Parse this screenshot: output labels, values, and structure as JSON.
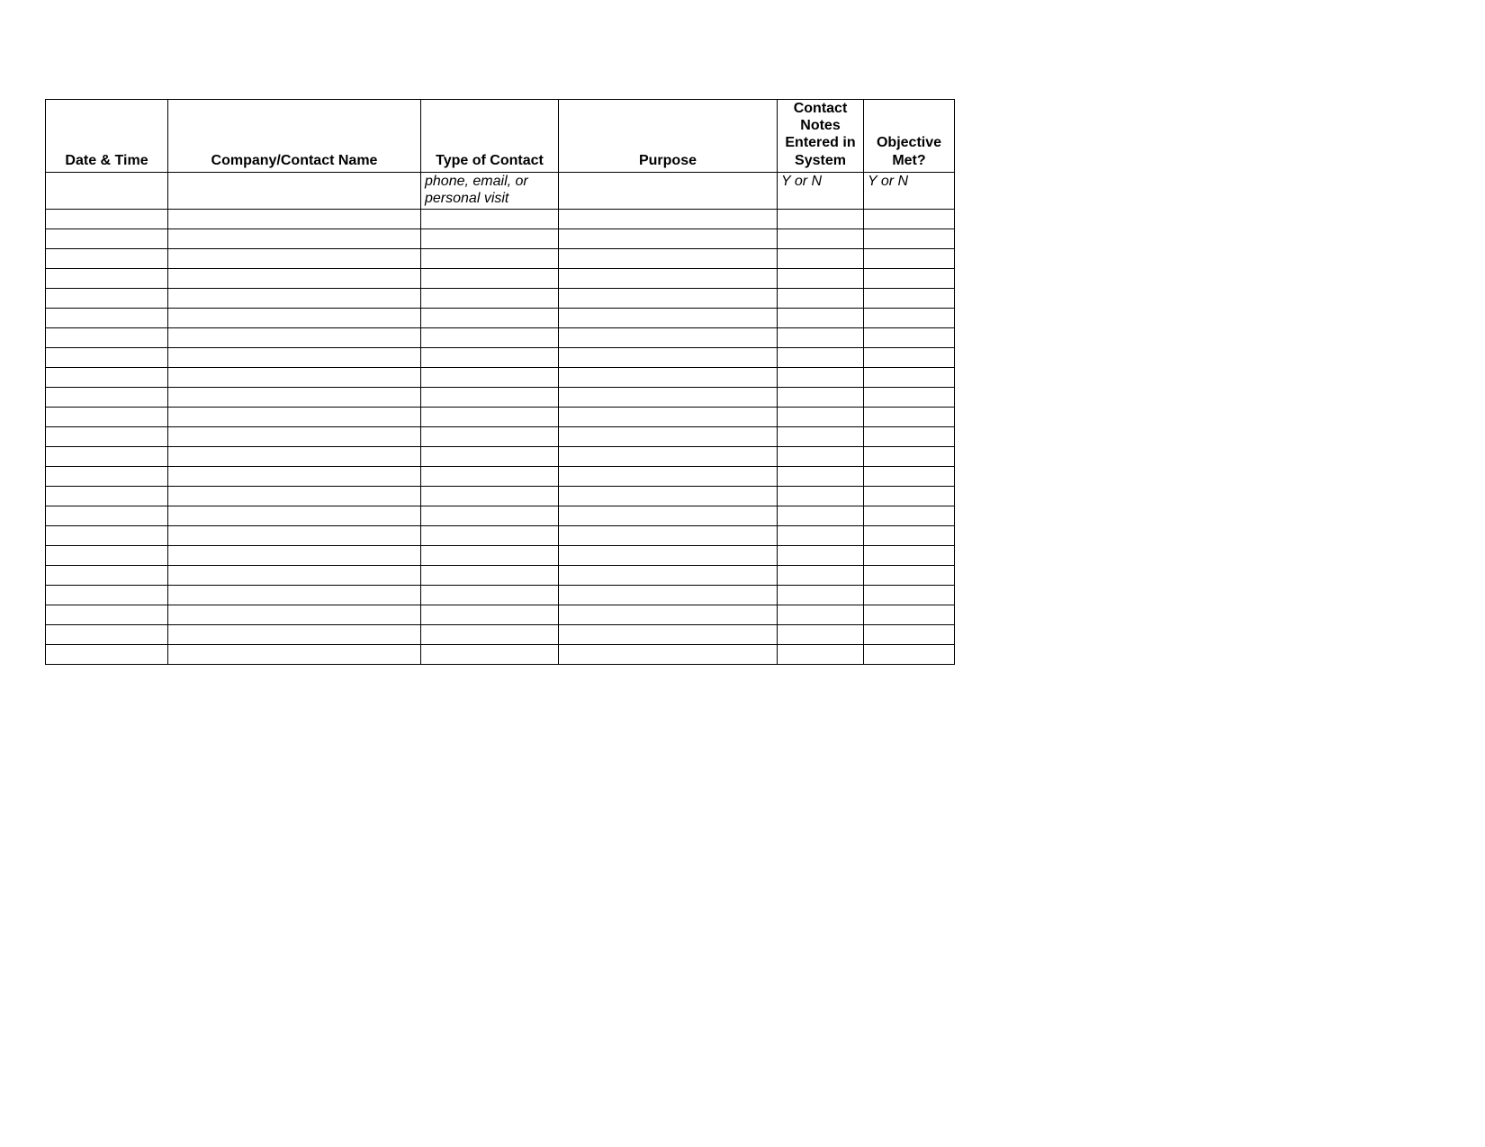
{
  "table": {
    "headers": {
      "date_time": "Date & Time",
      "company_contact": "Company/Contact Name",
      "type_of_contact": "Type of Contact",
      "purpose": "Purpose",
      "notes_entered": "Contact Notes Entered in System",
      "objective_met": "Objective Met?"
    },
    "hints": {
      "type_of_contact": "phone, email, or personal visit",
      "notes_entered": "Y or N",
      "objective_met": "Y or N"
    },
    "empty_row_count": 23
  }
}
